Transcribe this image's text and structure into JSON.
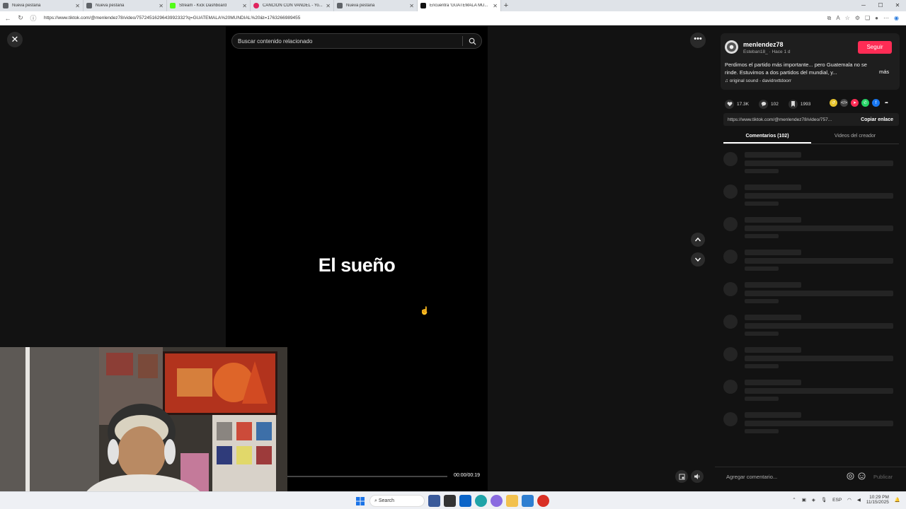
{
  "browser": {
    "tabs": [
      {
        "label": "Nueva pestaña",
        "color": "#5f6368",
        "active": false
      },
      {
        "label": "Nueva pestaña",
        "color": "#5f6368",
        "active": false
      },
      {
        "label": "Stream - Kick Dashboard",
        "color": "#53fc18",
        "active": false
      },
      {
        "label": "CANCIÓN CON VANDEL - Yo...",
        "color": "#e0245e",
        "active": false
      },
      {
        "label": "Nueva pestaña",
        "color": "#5f6368",
        "active": false
      },
      {
        "label": "Encuentra 'GUATEMALA MU...",
        "color": "#111111",
        "active": true
      }
    ],
    "url": "https://www.tiktok.com/@menlendez78/video/7572451629643992332?q=GUATEMALA%20MUNDIAL%20&t=1763266989455"
  },
  "video": {
    "search_placeholder": "Buscar contenido relacionado",
    "overlay_text": "El sueño",
    "time": "00:00/00:19",
    "progress": 0
  },
  "post": {
    "author": "menlendez78",
    "sub": "Esteban18_ · Hace 1 d",
    "follow_label": "Seguir",
    "description": "Perdimos el partido más importante... pero Guatemala no se rinde. Estuvimos a dos partidos del mundial, y...",
    "more_label": "más",
    "sound": "original sound - davidnxttdoorr",
    "likes": "17.3K",
    "comments": "102",
    "saves": "1993",
    "link": "https://www.tiktok.com/@menlendez78/video/757...",
    "copy_label": "Copiar enlace",
    "tab_comments": "Comentarios (102)",
    "tab_creator": "Videos del creador",
    "comment_placeholder": "Agregar comentario...",
    "publish_label": "Publicar"
  },
  "taskbar": {
    "search_label": "Search",
    "lang": "ESP",
    "time": "10:29 PM",
    "date": "11/15/2025"
  },
  "colors": {
    "accent": "#fe2c55",
    "background": "#121212"
  }
}
